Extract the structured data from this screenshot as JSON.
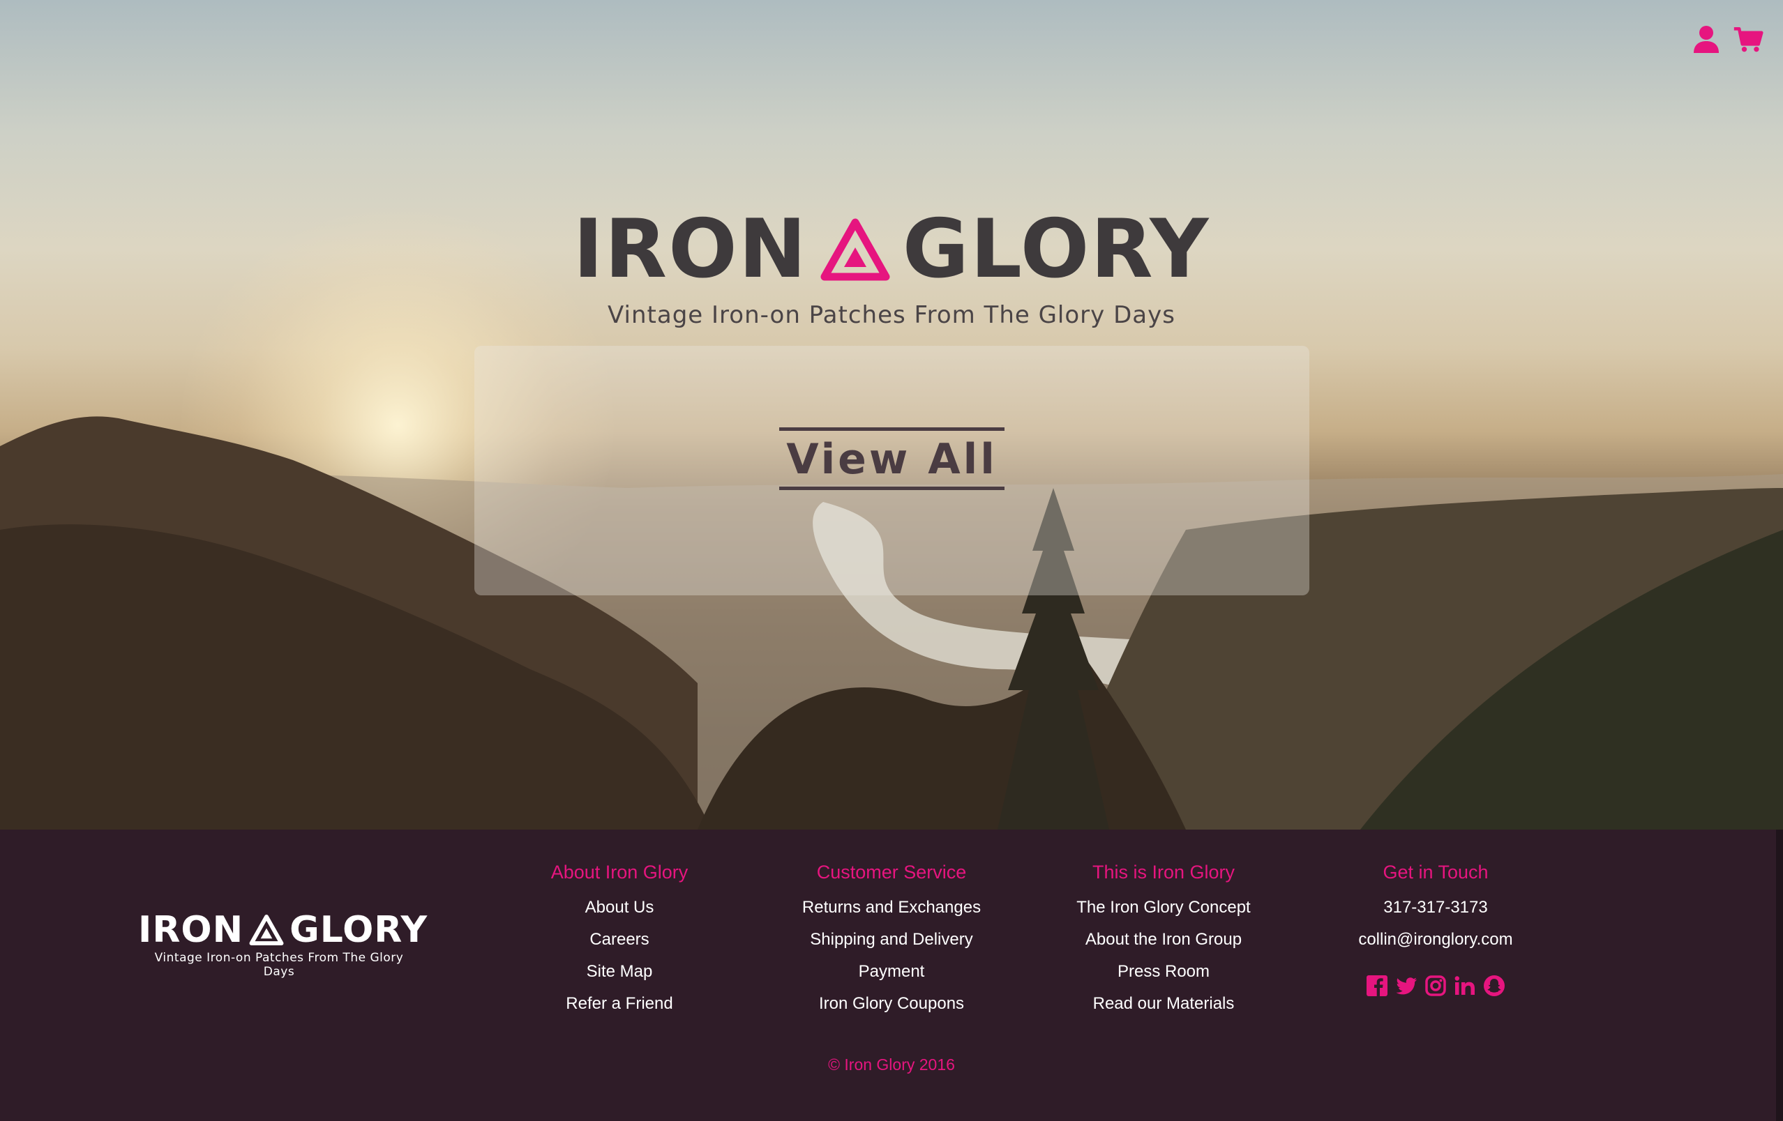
{
  "colors": {
    "accent": "#e6157f",
    "footer_bg": "#2f1c28",
    "logo_dark": "#3e3a3c"
  },
  "header": {
    "icons": [
      "user-icon",
      "cart-icon"
    ]
  },
  "hero": {
    "logo_left": "IRON",
    "logo_right": "GLORY",
    "tagline": "Vintage Iron-on Patches From The Glory Days",
    "cta_label": "View All"
  },
  "footer": {
    "logo_left": "IRON",
    "logo_right": "GLORY",
    "tagline": "Vintage Iron-on Patches From The Glory Days",
    "columns": [
      {
        "title": "About Iron Glory",
        "links": [
          "About Us",
          "Careers",
          "Site Map",
          "Refer a Friend"
        ]
      },
      {
        "title": "Customer Service",
        "links": [
          "Returns and Exchanges",
          "Shipping and Delivery",
          "Payment",
          "Iron Glory Coupons"
        ]
      },
      {
        "title": "This is Iron Glory",
        "links": [
          "The Iron Glory Concept",
          "About the Iron Group",
          "Press Room",
          "Read our Materials"
        ]
      },
      {
        "title": "Get in Touch",
        "links": [
          "317-317-3173",
          "collin@ironglory.com"
        ]
      }
    ],
    "social_icons": [
      "facebook-icon",
      "twitter-icon",
      "instagram-icon",
      "linkedin-icon",
      "snapchat-icon"
    ],
    "copyright": "© Iron Glory 2016"
  }
}
